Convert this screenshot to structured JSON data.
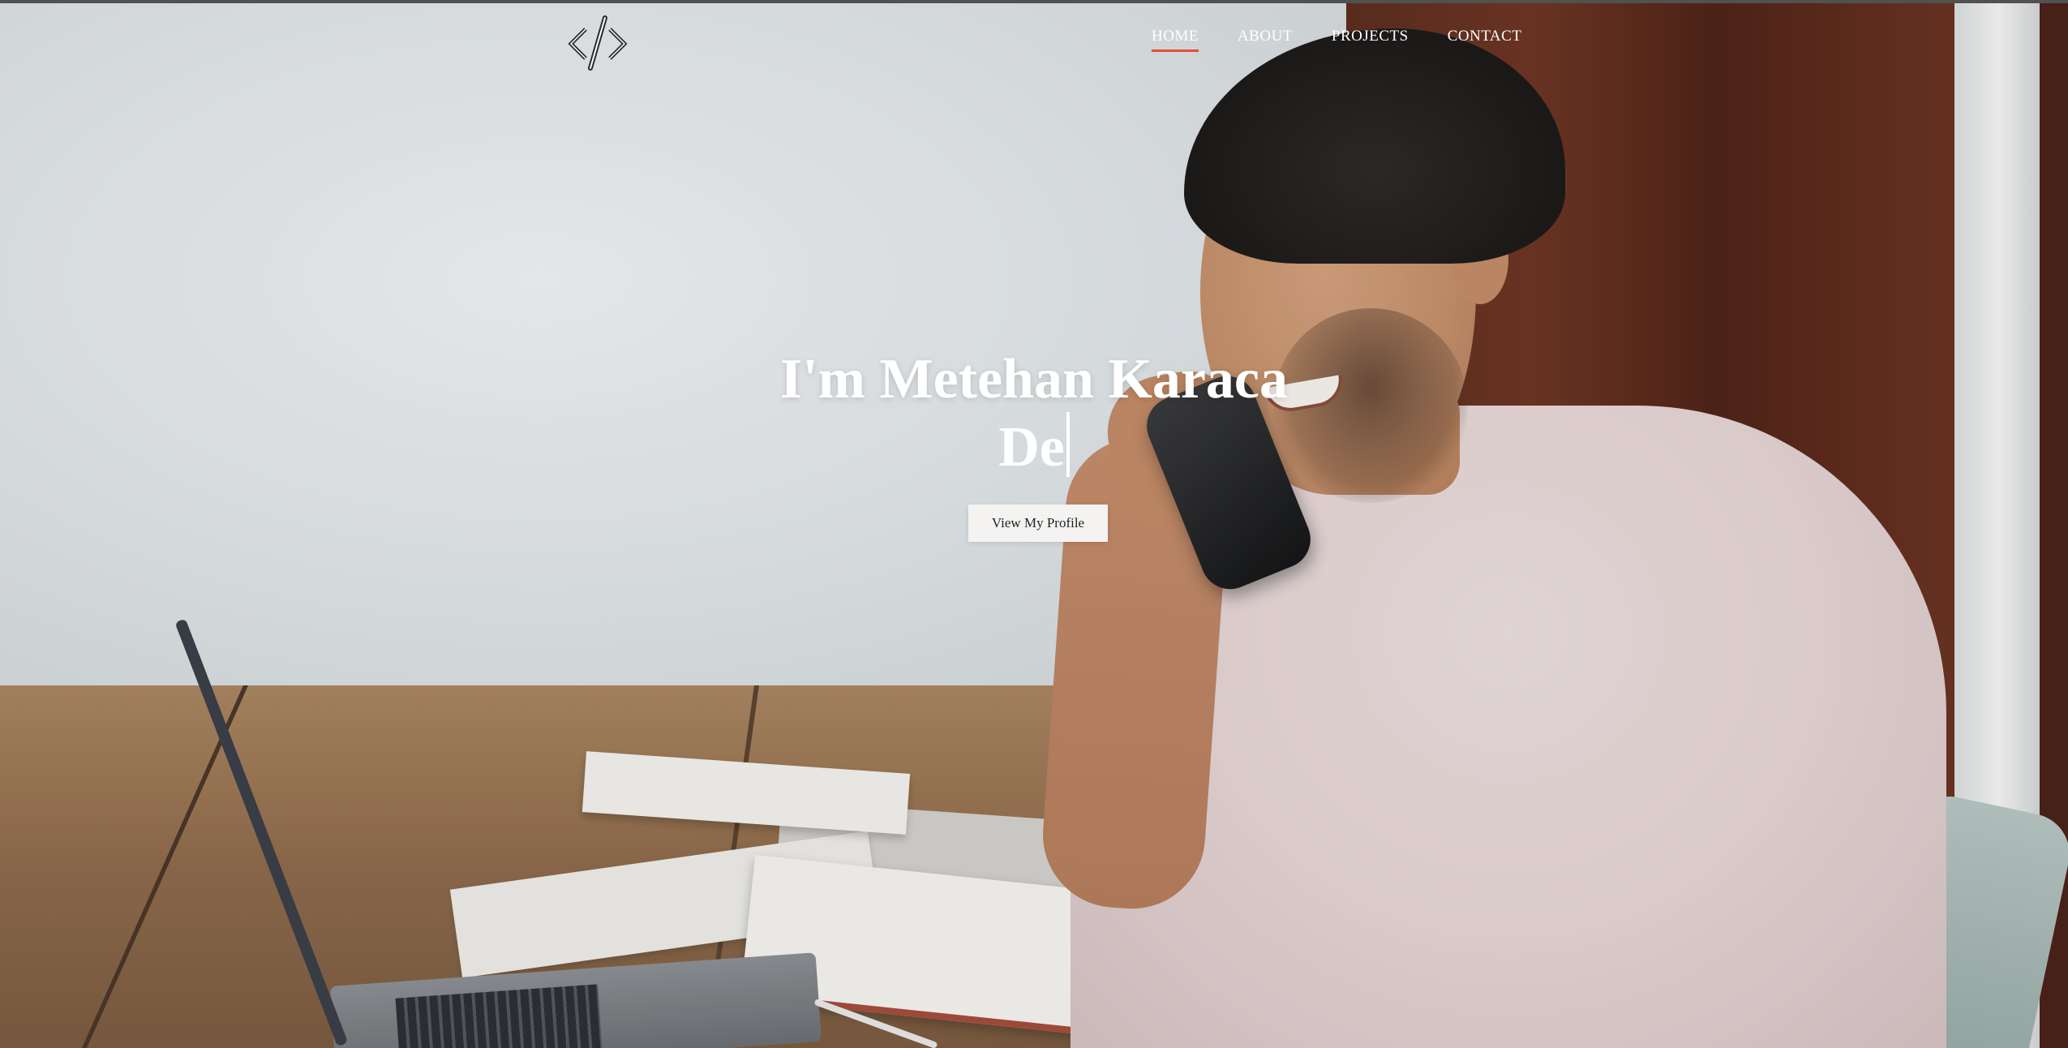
{
  "nav": {
    "logo_icon": "code-brackets-icon",
    "items": [
      {
        "label": "HOME",
        "active": true
      },
      {
        "label": "ABOUT",
        "active": false
      },
      {
        "label": "PROJECTS",
        "active": false
      },
      {
        "label": "CONTACT",
        "active": false
      }
    ],
    "active_underline_color": "#e74c3c"
  },
  "hero": {
    "title": "I'm Metehan Karaca",
    "typed_text": "De",
    "button_label": "View My Profile",
    "background_image": "man-on-phone-at-desk-photo"
  }
}
